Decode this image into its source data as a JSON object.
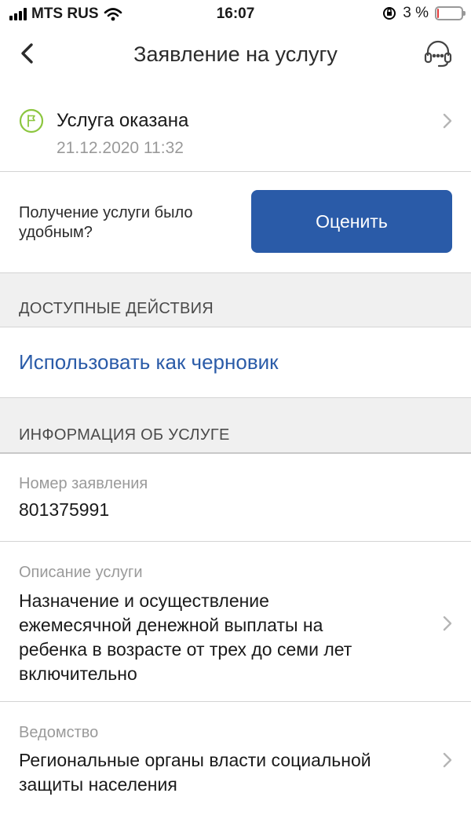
{
  "status_bar": {
    "carrier": "MTS RUS",
    "time": "16:07",
    "battery_text": "3 %",
    "battery_level_percent": 3
  },
  "nav": {
    "title": "Заявление на услугу",
    "back_icon": "chevron-left-icon",
    "support_icon": "headset-icon"
  },
  "status": {
    "title": "Услуга оказана",
    "date": "21.12.2020 11:32",
    "icon": "flag-icon",
    "accent_color": "#8cc63f"
  },
  "rating": {
    "question": "Получение услуги было удобным?",
    "button_label": "Оценить",
    "button_color": "#2a5ba8"
  },
  "actions": {
    "header": "ДОСТУПНЫЕ ДЕЙСТВИЯ",
    "draft_link": "Использовать как черновик",
    "link_color": "#2a5ba8"
  },
  "info": {
    "header": "ИНФОРМАЦИЯ ОБ УСЛУГЕ",
    "application_number_label": "Номер заявления",
    "application_number": "801375991",
    "description_label": "Описание услуги",
    "description_lines": [
      "Назначение и осуществление",
      "ежемесячной денежной выплаты на",
      "ребенка в возрасте от трех до семи лет",
      "включительно"
    ],
    "department_label": "Ведомство",
    "department_lines": [
      "Региональные органы власти социальной",
      "защиты населения"
    ]
  }
}
